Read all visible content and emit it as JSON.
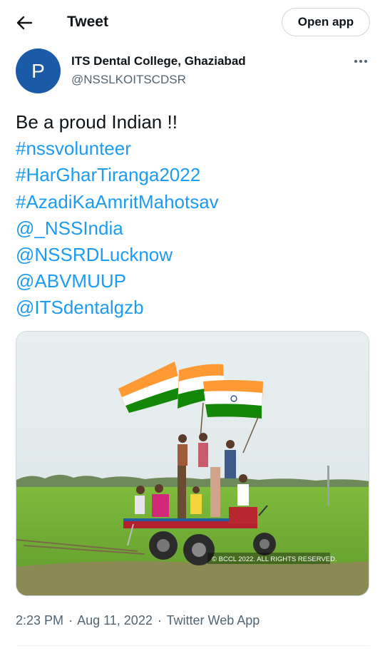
{
  "header": {
    "title": "Tweet",
    "open_app_label": "Open app"
  },
  "author": {
    "avatar_letter": "P",
    "name": "ITS Dental College, Ghaziabad",
    "handle": "@NSSLKOITSCDSR"
  },
  "tweet": {
    "lines": [
      {
        "text": "Be a proud Indian !!",
        "is_link": false
      },
      {
        "text": "#nssvolunteer",
        "is_link": true
      },
      {
        "text": "#HarGharTiranga2022",
        "is_link": true
      },
      {
        "text": "#AzadiKaAmritMahotsav",
        "is_link": true
      },
      {
        "text": "@_NSSIndia",
        "is_link": true
      },
      {
        "text": "@NSSRDLucknow",
        "is_link": true
      },
      {
        "text": "@ABVMUUP",
        "is_link": true
      },
      {
        "text": "@ITSdentalgzb",
        "is_link": true
      }
    ],
    "image_watermark": "© BCCL 2022. ALL RIGHTS RESERVED."
  },
  "meta": {
    "time": "2:23 PM",
    "separator": "·",
    "date": "Aug 11, 2022",
    "source": "Twitter Web App"
  },
  "colors": {
    "link": "#1d9bf0",
    "secondary": "#536471",
    "avatar": "#1a5aa6"
  }
}
